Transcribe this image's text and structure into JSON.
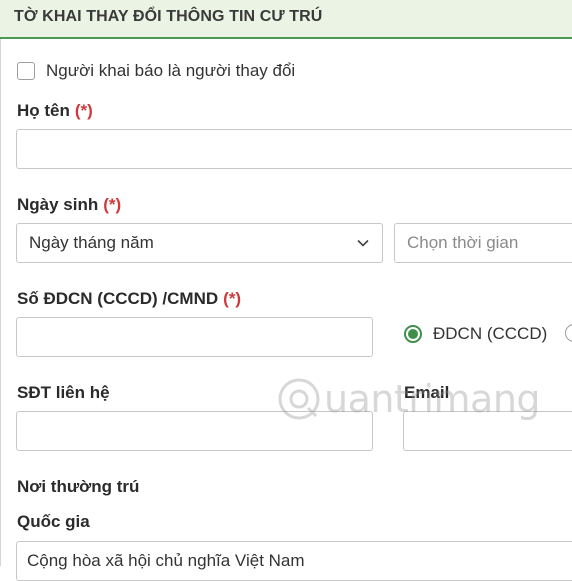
{
  "header": {
    "title": "TỜ KHAI THAY ĐỔI THÔNG TIN CƯ TRÚ"
  },
  "declarant_checkbox": {
    "label": "Người khai báo là người thay đổi",
    "checked": false
  },
  "required_marker": "(*)",
  "full_name": {
    "label": "Họ tên",
    "value": ""
  },
  "birth": {
    "label": "Ngày sinh",
    "format_select": "Ngày tháng năm",
    "date_placeholder": "Chọn thời gian"
  },
  "id_number": {
    "label": "Số ĐDCN (CCCD) /CMND",
    "value": "",
    "radio_option": "ĐDCN (CCCD)",
    "radio_selected": true
  },
  "phone": {
    "label": "SĐT liên hệ",
    "value": ""
  },
  "email": {
    "label": "Email",
    "value": ""
  },
  "permanent_residence": {
    "section_label": "Nơi thường trú",
    "country_label": "Quốc gia",
    "country_value": "Cộng hòa xã hội chủ nghĩa Việt Nam"
  },
  "watermark": {
    "text": "uantrimang"
  },
  "colors": {
    "accent_green": "#3f8e4a",
    "header_bg": "#eaf3e4",
    "required_red": "#d0393c"
  }
}
